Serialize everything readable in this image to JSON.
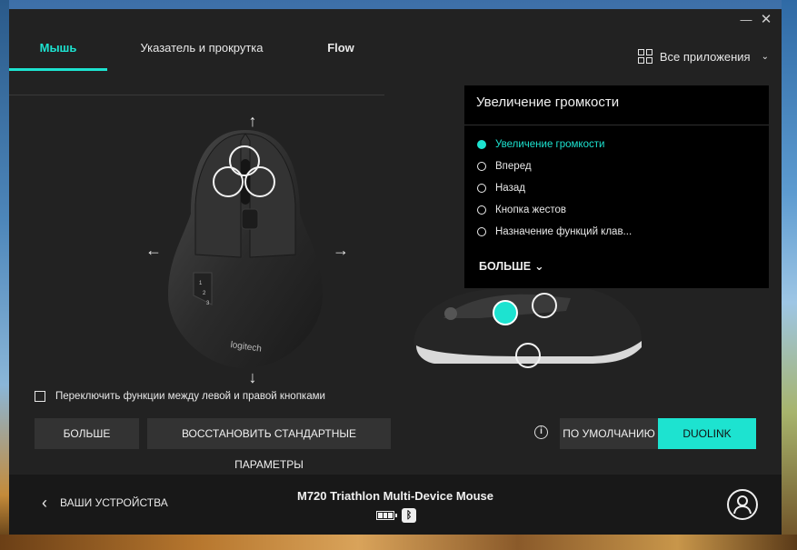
{
  "window": {
    "min_glyph": "—",
    "close_glyph": "✕"
  },
  "tabs": [
    {
      "label": "Мышь",
      "active": true
    },
    {
      "label": "Указатель и прокрутка",
      "active": false
    },
    {
      "label": "Flow",
      "active": false
    }
  ],
  "apps_selector": {
    "label": "Все приложения"
  },
  "mouse": {
    "brand_text": "logitech",
    "side_button_labels": [
      "1",
      "2",
      "3"
    ]
  },
  "panel": {
    "title": "Увеличение громкости",
    "options": [
      {
        "label": "Увеличение громкости",
        "selected": true
      },
      {
        "label": "Вперед",
        "selected": false
      },
      {
        "label": "Назад",
        "selected": false
      },
      {
        "label": "Кнопка жестов",
        "selected": false
      },
      {
        "label": "Назначение функций клав...",
        "selected": false
      }
    ],
    "more_label": "БОЛЬШЕ"
  },
  "swap_checkbox": {
    "label": "Переключить функции между левой и правой кнопками",
    "checked": false
  },
  "buttons": {
    "more": "БОЛЬШЕ",
    "restore": "ВОССТАНОВИТЬ СТАНДАРТНЫЕ ПАРАМЕТРЫ",
    "default": "ПО УМОЛЧАНИЮ",
    "duolink": "DUOLINK"
  },
  "footer": {
    "back_label": "ВАШИ УСТРОЙСТВА",
    "device_name": "M720 Triathlon Multi-Device Mouse"
  },
  "colors": {
    "accent": "#1de3d0",
    "window_bg": "#222222",
    "panel_bg": "#000000",
    "footer_bg": "#181818"
  }
}
